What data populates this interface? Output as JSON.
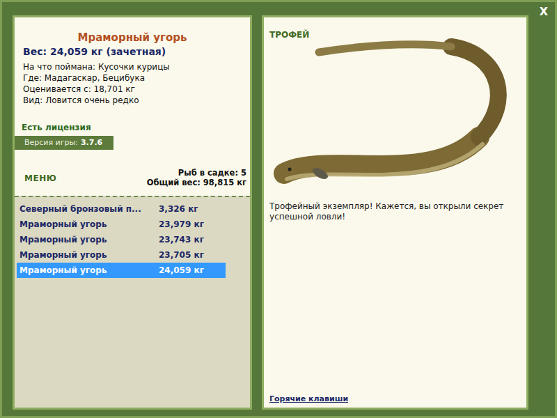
{
  "window": {
    "close": "X"
  },
  "catch": {
    "title": "Мраморный угорь",
    "weight": "Вес: 24,059 кг (зачетная)",
    "details": [
      "На что поймана: Кусочки курицы",
      "Где: Мадагаскар, Бецибука",
      "Оценивается с: 18,701 кг",
      "Вид: Ловится очень редко"
    ]
  },
  "license": "Есть лицензия",
  "version": {
    "label": "Версия игры:",
    "value": "3.7.6"
  },
  "menu": "МЕНЮ",
  "keepnet": {
    "count": "Рыб в садке: 5",
    "total": "Общий вес: 98,815 кг"
  },
  "fish_list": [
    {
      "name": "Северный бронзовый п...",
      "weight": "3,326 кг",
      "selected": false
    },
    {
      "name": "Мраморный угорь",
      "weight": "23,979 кг",
      "selected": false
    },
    {
      "name": "Мраморный угорь",
      "weight": "23,743 кг",
      "selected": false
    },
    {
      "name": "Мраморный угорь",
      "weight": "23,705 кг",
      "selected": false
    },
    {
      "name": "Мраморный угорь",
      "weight": "24,059 кг",
      "selected": true
    }
  ],
  "trophy": {
    "label": "ТРОФЕЙ",
    "message": "Трофейный экземпляр! Кажется, вы открыли секрет успешной ловли!"
  },
  "hotkeys": "Горячие клавиши"
}
